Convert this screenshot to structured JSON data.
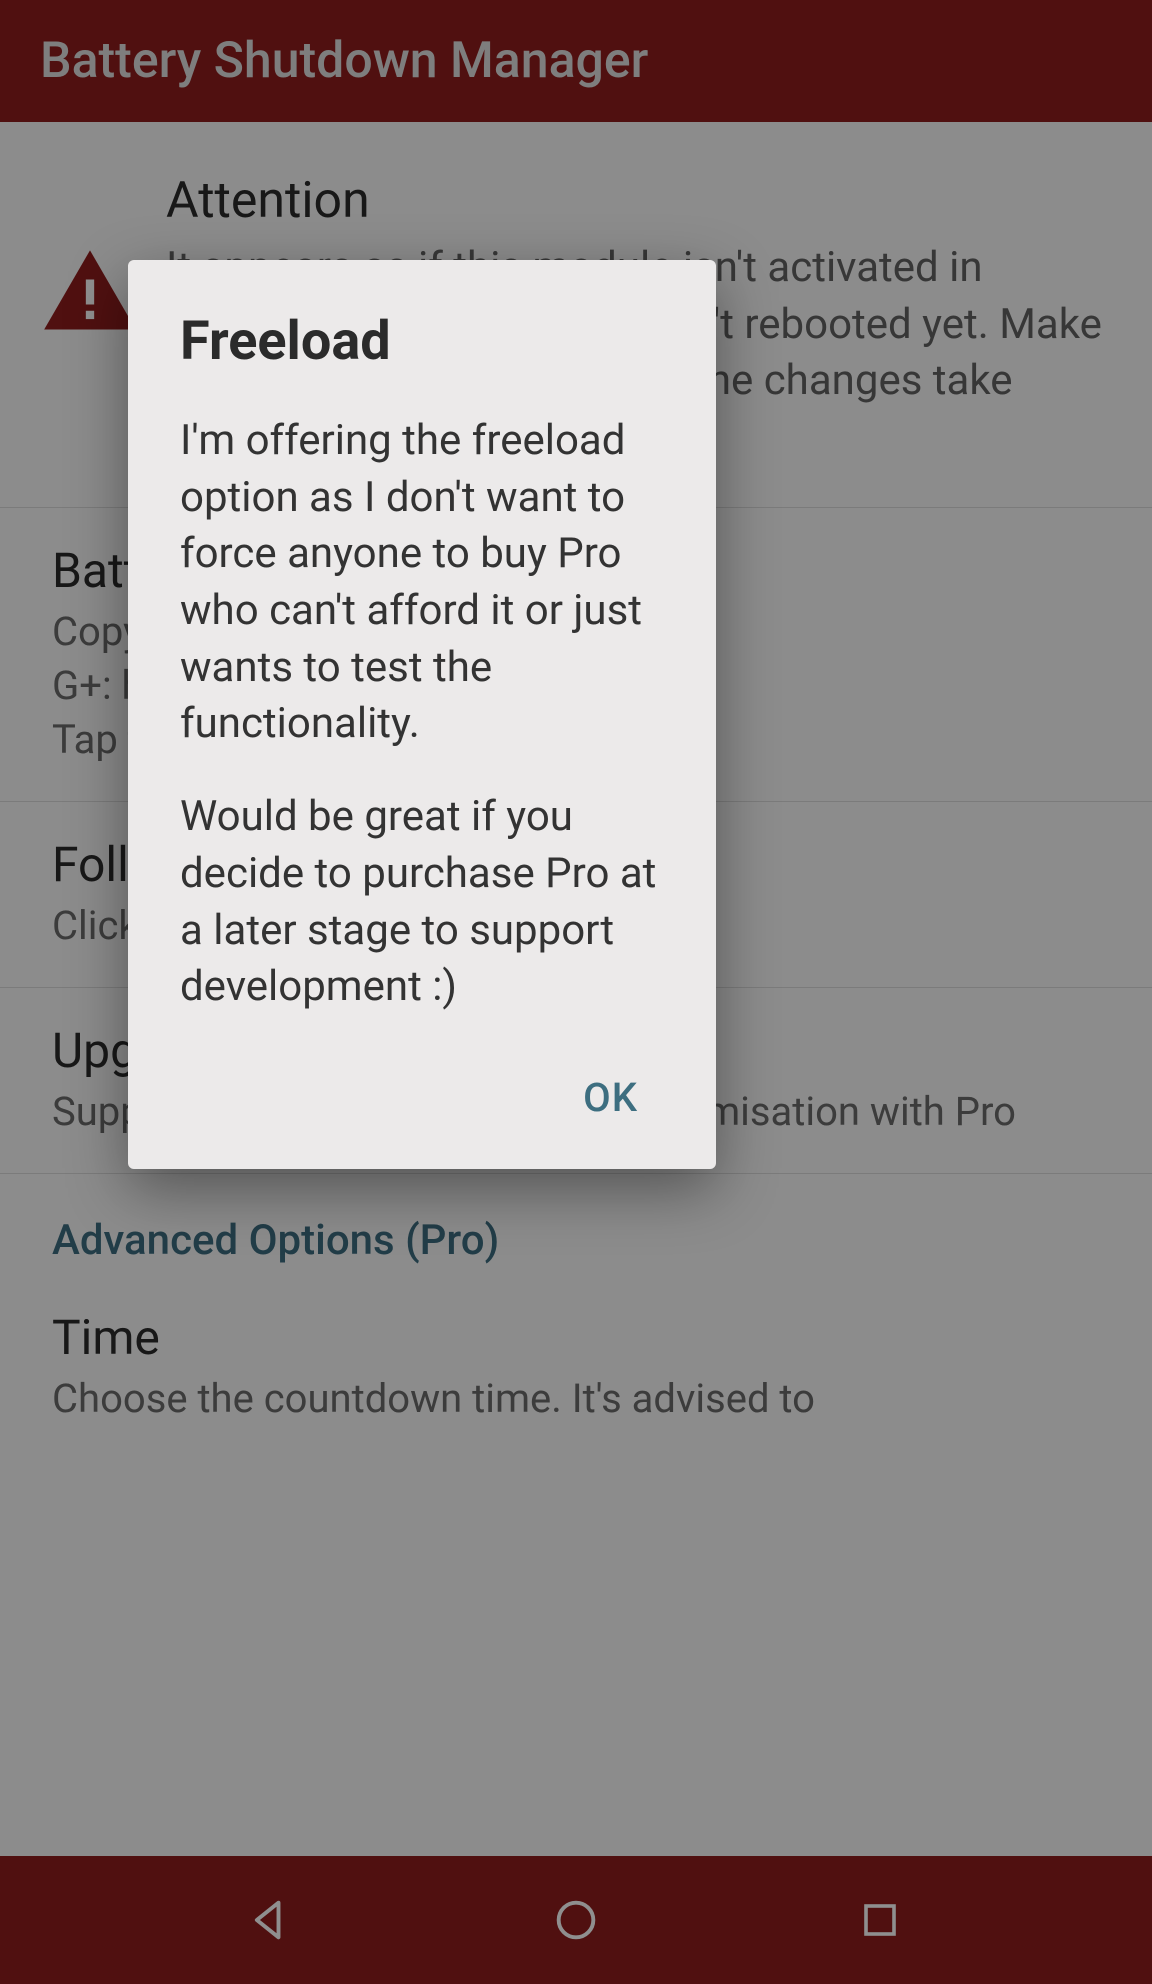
{
  "appbar": {
    "title": "Battery Shutdown Manager"
  },
  "attention": {
    "title": "Attention",
    "body": "It appears as if this module isn't activated in Xposed Installer or you haven't rebooted yet. Make sure it is, and reboot so that the changes take effect."
  },
  "items": [
    {
      "title": "Battery Shutdown Manager",
      "sub": "Copyright © 2015 Michael Bel\nG+: http://goo.gl/example\nTap to visit the Play Store"
    },
    {
      "title": "Follow me on G+ for updates",
      "sub": "Click here to add me to your circles"
    },
    {
      "title": "Upgrade",
      "sub": "Support development & unlock customisation with Pro"
    }
  ],
  "section": {
    "header": "Advanced Options (Pro)"
  },
  "time": {
    "title": "Time",
    "sub": "Choose the countdown time. It's advised to"
  },
  "dialog": {
    "title": "Freeload",
    "body1": "I'm offering the freeload option as I don't want to force anyone to buy Pro who can't afford it or just wants to test the functionality.",
    "body2": "Would be great if you decide to purchase Pro at a later stage to support development :)",
    "ok": "OK"
  }
}
